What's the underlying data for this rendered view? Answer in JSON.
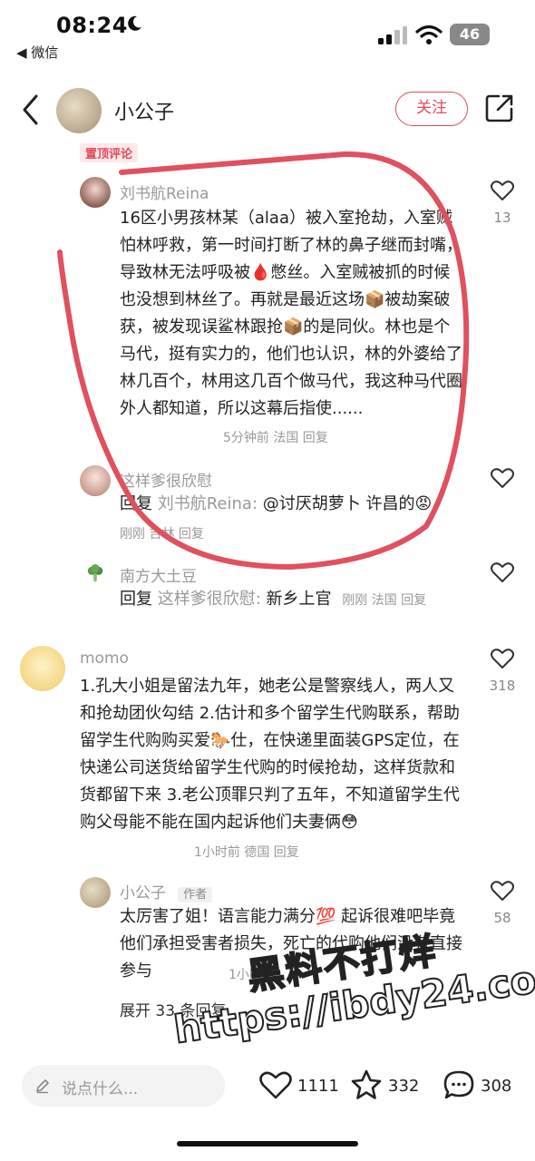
{
  "status_bar": {
    "time": "08:24",
    "back_app": "◀ 微信",
    "battery": "46"
  },
  "header": {
    "author_name": "小公子",
    "follow_label": "关注"
  },
  "pinned_tag": "置顶评论",
  "comments": [
    {
      "user": "刘书航Reina",
      "text": "16区小男孩林某（alaa）被入室抢劫，入室贼怕林呼救，第一时间打断了林的鼻子继而封嘴，导致林无法呼吸被🩸憋丝。入室贼被抓的时候也没想到林丝了。再就是最近这场📦被劫案破获，被发现误鲨林跟抢📦的是同伙。林也是个马代，挺有实力的，他们也认识，林的外婆给了林几百个，林用这几百个做马代，我这种马代圈外人都知道，所以这幕后指使......",
      "meta": "5分钟前 法国 回复",
      "likes": "13"
    },
    {
      "user": "这样爹很欣慰",
      "reply_prefix": "回复",
      "reply_target": "刘书航Reina:",
      "text": "@讨厌胡萝卜 许昌的😡",
      "meta": "刚刚 吉林 回复"
    },
    {
      "user": "南方大土豆",
      "reply_prefix": "回复",
      "reply_target": "这样爹很欣慰:",
      "text": "新乡上官",
      "meta": "刚刚 法国 回复"
    },
    {
      "user": "momo",
      "text": "1.孔大小姐是留法九年，她老公是警察线人，两人又和抢劫团伙勾结 2.估计和多个留学生代购联系，帮助留学生代购购买爱🐎仕，在快递里面装GPS定位，在快递公司送货给留学生代购的时候抢劫，这样货款和货都留下来 3.老公顶罪只判了五年，不知道留学生代购父母能不能在国内起诉他们夫妻俩😳",
      "meta": "1小时前 德国 回复",
      "likes": "318"
    },
    {
      "user": "小公子",
      "badge": "作者",
      "text": "太厉害了姐！语言能力满分💯 起诉很难吧毕竟他们承担受害者损失，死亡的代购他们没有直接参与",
      "meta": "1小时前",
      "likes": "58"
    }
  ],
  "expand_label": "展开 33 条回复",
  "watermark": {
    "line1": "黑料不打烊",
    "line2": "https://ibdy24.com"
  },
  "bottom_bar": {
    "placeholder": "说点什么...",
    "likes": "1111",
    "stars": "332",
    "comments": "308"
  },
  "colors": {
    "accent": "#e34a5a",
    "circle_annotation": "#e0505e"
  }
}
